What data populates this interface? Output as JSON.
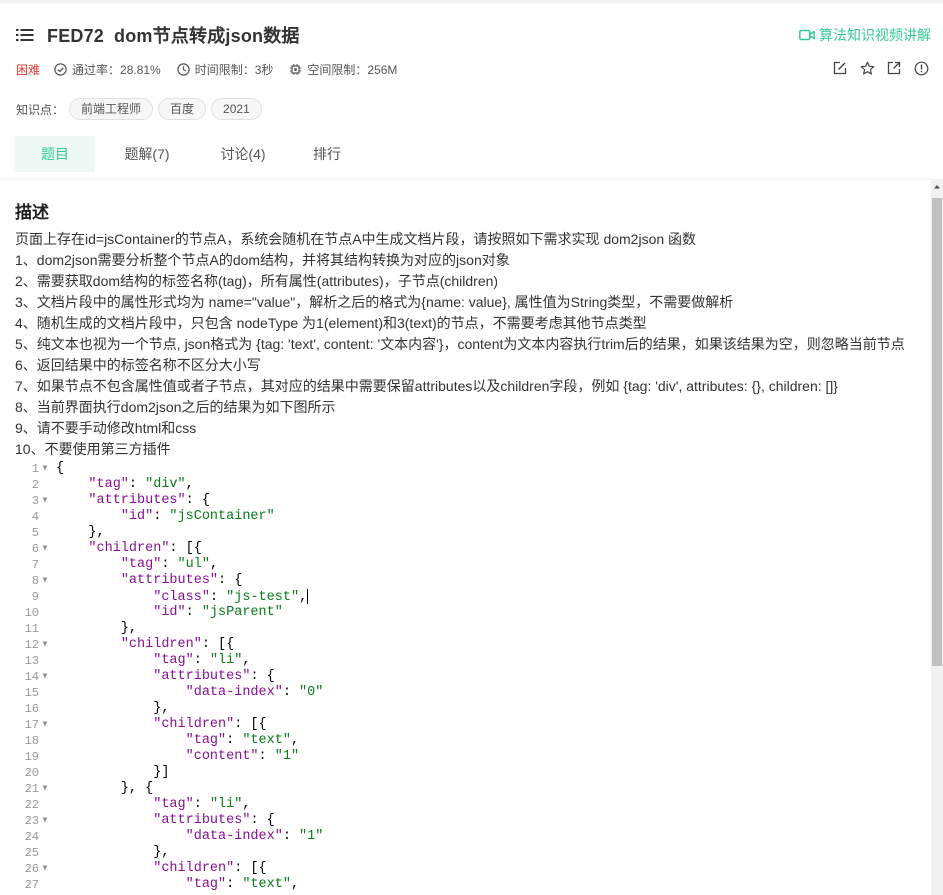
{
  "header": {
    "problem_code": "FED72",
    "problem_title": "dom节点转成json数据",
    "video_link": "算法知识视频讲解",
    "difficulty": "困难",
    "pass_rate": "通过率：28.81%",
    "time_limit": "时间限制：3秒",
    "space_limit": "空间限制：256M",
    "knowledge_label": "知识点：",
    "tags": [
      "前端工程师",
      "百度",
      "2021"
    ]
  },
  "tabs": [
    {
      "label": "题目",
      "active": true
    },
    {
      "label": "题解(7)",
      "active": false
    },
    {
      "label": "讨论(4)",
      "active": false
    },
    {
      "label": "排行",
      "active": false
    }
  ],
  "description": {
    "title": "描述",
    "lines": [
      "页面上存在id=jsContainer的节点A，系统会随机在节点A中生成文档片段，请按照如下需求实现 dom2json 函数",
      "1、dom2json需要分析整个节点A的dom结构，并将其结构转换为对应的json对象",
      "2、需要获取dom结构的标签名称(tag)，所有属性(attributes)，子节点(children)",
      "3、文档片段中的属性形式均为 name=\"value\"，解析之后的格式为{name: value}, 属性值为String类型，不需要做解析",
      "4、随机生成的文档片段中，只包含 nodeType 为1(element)和3(text)的节点，不需要考虑其他节点类型",
      "5、纯文本也视为一个节点, json格式为 {tag: 'text', content: '文本内容'}，content为文本内容执行trim后的结果，如果该结果为空，则忽略当前节点",
      "6、返回结果中的标签名称不区分大小写",
      "7、如果节点不包含属性值或者子节点，其对应的结果中需要保留attributes以及children字段，例如 {tag: 'div', attributes: {}, children: []}",
      "8、当前界面执行dom2json之后的结果为如下图所示",
      "9、请不要手动修改html和css",
      "10、不要使用第三方插件"
    ]
  },
  "code": {
    "lines": [
      {
        "n": "1",
        "fold": true,
        "t": [
          [
            "p",
            "{"
          ]
        ]
      },
      {
        "n": "2",
        "fold": false,
        "t": [
          [
            "p",
            "    "
          ],
          [
            "k",
            "\"tag\""
          ],
          [
            "p",
            ": "
          ],
          [
            "s",
            "\"div\""
          ],
          [
            "p",
            ","
          ]
        ]
      },
      {
        "n": "3",
        "fold": true,
        "t": [
          [
            "p",
            "    "
          ],
          [
            "k",
            "\"attributes\""
          ],
          [
            "p",
            ": {"
          ]
        ]
      },
      {
        "n": "4",
        "fold": false,
        "t": [
          [
            "p",
            "        "
          ],
          [
            "k",
            "\"id\""
          ],
          [
            "p",
            ": "
          ],
          [
            "s",
            "\"jsContainer\""
          ]
        ]
      },
      {
        "n": "5",
        "fold": false,
        "t": [
          [
            "p",
            "    },"
          ]
        ]
      },
      {
        "n": "6",
        "fold": true,
        "t": [
          [
            "p",
            "    "
          ],
          [
            "k",
            "\"children\""
          ],
          [
            "p",
            ": [{"
          ]
        ]
      },
      {
        "n": "7",
        "fold": false,
        "t": [
          [
            "p",
            "        "
          ],
          [
            "k",
            "\"tag\""
          ],
          [
            "p",
            ": "
          ],
          [
            "s",
            "\"ul\""
          ],
          [
            "p",
            ","
          ]
        ]
      },
      {
        "n": "8",
        "fold": true,
        "t": [
          [
            "p",
            "        "
          ],
          [
            "k",
            "\"attributes\""
          ],
          [
            "p",
            ": {"
          ]
        ]
      },
      {
        "n": "9",
        "fold": false,
        "t": [
          [
            "p",
            "            "
          ],
          [
            "k",
            "\"class\""
          ],
          [
            "p",
            ": "
          ],
          [
            "s",
            "\"js-test\""
          ],
          [
            "p",
            ","
          ],
          [
            "c",
            ""
          ]
        ]
      },
      {
        "n": "10",
        "fold": false,
        "t": [
          [
            "p",
            "            "
          ],
          [
            "k",
            "\"id\""
          ],
          [
            "p",
            ": "
          ],
          [
            "s",
            "\"jsParent\""
          ]
        ]
      },
      {
        "n": "11",
        "fold": false,
        "t": [
          [
            "p",
            "        },"
          ]
        ]
      },
      {
        "n": "12",
        "fold": true,
        "t": [
          [
            "p",
            "        "
          ],
          [
            "k",
            "\"children\""
          ],
          [
            "p",
            ": [{"
          ]
        ]
      },
      {
        "n": "13",
        "fold": false,
        "t": [
          [
            "p",
            "            "
          ],
          [
            "k",
            "\"tag\""
          ],
          [
            "p",
            ": "
          ],
          [
            "s",
            "\"li\""
          ],
          [
            "p",
            ","
          ]
        ]
      },
      {
        "n": "14",
        "fold": true,
        "t": [
          [
            "p",
            "            "
          ],
          [
            "k",
            "\"attributes\""
          ],
          [
            "p",
            ": {"
          ]
        ]
      },
      {
        "n": "15",
        "fold": false,
        "t": [
          [
            "p",
            "                "
          ],
          [
            "k",
            "\"data-index\""
          ],
          [
            "p",
            ": "
          ],
          [
            "s",
            "\"0\""
          ]
        ]
      },
      {
        "n": "16",
        "fold": false,
        "t": [
          [
            "p",
            "            },"
          ]
        ]
      },
      {
        "n": "17",
        "fold": true,
        "t": [
          [
            "p",
            "            "
          ],
          [
            "k",
            "\"children\""
          ],
          [
            "p",
            ": [{"
          ]
        ]
      },
      {
        "n": "18",
        "fold": false,
        "t": [
          [
            "p",
            "                "
          ],
          [
            "k",
            "\"tag\""
          ],
          [
            "p",
            ": "
          ],
          [
            "s",
            "\"text\""
          ],
          [
            "p",
            ","
          ]
        ]
      },
      {
        "n": "19",
        "fold": false,
        "t": [
          [
            "p",
            "                "
          ],
          [
            "k",
            "\"content\""
          ],
          [
            "p",
            ": "
          ],
          [
            "s",
            "\"1\""
          ]
        ]
      },
      {
        "n": "20",
        "fold": false,
        "t": [
          [
            "p",
            "            }]"
          ]
        ]
      },
      {
        "n": "21",
        "fold": true,
        "t": [
          [
            "p",
            "        }, {"
          ]
        ]
      },
      {
        "n": "22",
        "fold": false,
        "t": [
          [
            "p",
            "            "
          ],
          [
            "k",
            "\"tag\""
          ],
          [
            "p",
            ": "
          ],
          [
            "s",
            "\"li\""
          ],
          [
            "p",
            ","
          ]
        ]
      },
      {
        "n": "23",
        "fold": true,
        "t": [
          [
            "p",
            "            "
          ],
          [
            "k",
            "\"attributes\""
          ],
          [
            "p",
            ": {"
          ]
        ]
      },
      {
        "n": "24",
        "fold": false,
        "t": [
          [
            "p",
            "                "
          ],
          [
            "k",
            "\"data-index\""
          ],
          [
            "p",
            ": "
          ],
          [
            "s",
            "\"1\""
          ]
        ]
      },
      {
        "n": "25",
        "fold": false,
        "t": [
          [
            "p",
            "            },"
          ]
        ]
      },
      {
        "n": "26",
        "fold": true,
        "t": [
          [
            "p",
            "            "
          ],
          [
            "k",
            "\"children\""
          ],
          [
            "p",
            ": [{"
          ]
        ]
      },
      {
        "n": "27",
        "fold": false,
        "t": [
          [
            "p",
            "                "
          ],
          [
            "k",
            "\"tag\""
          ],
          [
            "p",
            ": "
          ],
          [
            "s",
            "\"text\""
          ],
          [
            "p",
            ","
          ]
        ]
      }
    ]
  },
  "colors": {
    "accent": "#32ca99",
    "difficulty": "#e53935",
    "json_key": "#871094",
    "json_string": "#067d17"
  }
}
